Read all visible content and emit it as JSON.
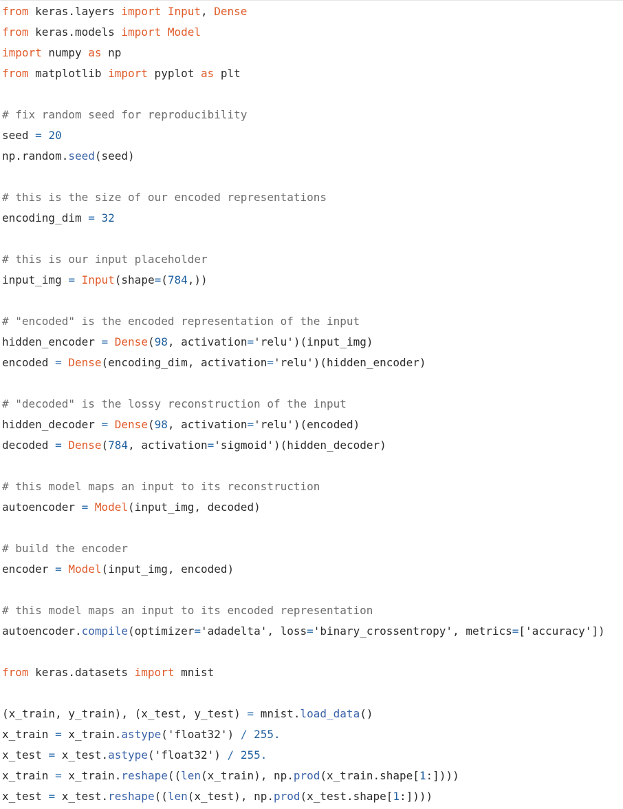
{
  "colors": {
    "background": "#ffffff",
    "text": "#2b2b2b",
    "keyword": "#e05a28",
    "number": "#1f5f9e",
    "operator": "#2f6fad",
    "comment": "#6d6d6d",
    "method": "#3a63a8"
  },
  "code_lines": [
    {
      "tokens": [
        [
          "kw",
          "from"
        ],
        [
          "plain",
          " keras.layers "
        ],
        [
          "kw",
          "import"
        ],
        [
          "plain",
          " "
        ],
        [
          "kw",
          "Input"
        ],
        [
          "plain",
          ", "
        ],
        [
          "kw",
          "Dense"
        ]
      ]
    },
    {
      "tokens": [
        [
          "kw",
          "from"
        ],
        [
          "plain",
          " keras.models "
        ],
        [
          "kw",
          "import"
        ],
        [
          "plain",
          " "
        ],
        [
          "kw",
          "Model"
        ]
      ]
    },
    {
      "tokens": [
        [
          "kw",
          "import"
        ],
        [
          "plain",
          " numpy "
        ],
        [
          "kw",
          "as"
        ],
        [
          "plain",
          " np"
        ]
      ]
    },
    {
      "tokens": [
        [
          "kw",
          "from"
        ],
        [
          "plain",
          " matplotlib "
        ],
        [
          "kw",
          "import"
        ],
        [
          "plain",
          " pyplot "
        ],
        [
          "kw",
          "as"
        ],
        [
          "plain",
          " plt"
        ]
      ]
    },
    {
      "tokens": []
    },
    {
      "tokens": [
        [
          "com",
          "# fix random seed for reproducibility"
        ]
      ]
    },
    {
      "tokens": [
        [
          "plain",
          "seed "
        ],
        [
          "op",
          "="
        ],
        [
          "plain",
          " "
        ],
        [
          "num",
          "20"
        ]
      ]
    },
    {
      "tokens": [
        [
          "plain",
          "np.random."
        ],
        [
          "meth",
          "seed"
        ],
        [
          "plain",
          "(seed)"
        ]
      ]
    },
    {
      "tokens": []
    },
    {
      "tokens": [
        [
          "com",
          "# this is the size of our encoded representations"
        ]
      ]
    },
    {
      "tokens": [
        [
          "plain",
          "encoding_dim "
        ],
        [
          "op",
          "="
        ],
        [
          "plain",
          " "
        ],
        [
          "num",
          "32"
        ]
      ]
    },
    {
      "tokens": []
    },
    {
      "tokens": [
        [
          "com",
          "# this is our input placeholder"
        ]
      ]
    },
    {
      "tokens": [
        [
          "plain",
          "input_img "
        ],
        [
          "op",
          "="
        ],
        [
          "plain",
          " "
        ],
        [
          "kw",
          "Input"
        ],
        [
          "plain",
          "(shape"
        ],
        [
          "op",
          "="
        ],
        [
          "plain",
          "("
        ],
        [
          "num",
          "784"
        ],
        [
          "plain",
          ",))"
        ]
      ]
    },
    {
      "tokens": []
    },
    {
      "tokens": [
        [
          "com",
          "# \"encoded\" is the encoded representation of the input"
        ]
      ]
    },
    {
      "tokens": [
        [
          "plain",
          "hidden_encoder "
        ],
        [
          "op",
          "="
        ],
        [
          "plain",
          " "
        ],
        [
          "kw",
          "Dense"
        ],
        [
          "plain",
          "("
        ],
        [
          "num",
          "98"
        ],
        [
          "plain",
          ", activation"
        ],
        [
          "op",
          "="
        ],
        [
          "str",
          "'relu'"
        ],
        [
          "plain",
          ")(input_img)"
        ]
      ]
    },
    {
      "tokens": [
        [
          "plain",
          "encoded "
        ],
        [
          "op",
          "="
        ],
        [
          "plain",
          " "
        ],
        [
          "kw",
          "Dense"
        ],
        [
          "plain",
          "(encoding_dim, activation"
        ],
        [
          "op",
          "="
        ],
        [
          "str",
          "'relu'"
        ],
        [
          "plain",
          ")(hidden_encoder)"
        ]
      ]
    },
    {
      "tokens": []
    },
    {
      "tokens": [
        [
          "com",
          "# \"decoded\" is the lossy reconstruction of the input"
        ]
      ]
    },
    {
      "tokens": [
        [
          "plain",
          "hidden_decoder "
        ],
        [
          "op",
          "="
        ],
        [
          "plain",
          " "
        ],
        [
          "kw",
          "Dense"
        ],
        [
          "plain",
          "("
        ],
        [
          "num",
          "98"
        ],
        [
          "plain",
          ", activation"
        ],
        [
          "op",
          "="
        ],
        [
          "str",
          "'relu'"
        ],
        [
          "plain",
          ")(encoded)"
        ]
      ]
    },
    {
      "tokens": [
        [
          "plain",
          "decoded "
        ],
        [
          "op",
          "="
        ],
        [
          "plain",
          " "
        ],
        [
          "kw",
          "Dense"
        ],
        [
          "plain",
          "("
        ],
        [
          "num",
          "784"
        ],
        [
          "plain",
          ", activation"
        ],
        [
          "op",
          "="
        ],
        [
          "str",
          "'sigmoid'"
        ],
        [
          "plain",
          ")(hidden_decoder)"
        ]
      ]
    },
    {
      "tokens": []
    },
    {
      "tokens": [
        [
          "com",
          "# this model maps an input to its reconstruction"
        ]
      ]
    },
    {
      "tokens": [
        [
          "plain",
          "autoencoder "
        ],
        [
          "op",
          "="
        ],
        [
          "plain",
          " "
        ],
        [
          "kw",
          "Model"
        ],
        [
          "plain",
          "(input_img, decoded)"
        ]
      ]
    },
    {
      "tokens": []
    },
    {
      "tokens": [
        [
          "com",
          "# build the encoder"
        ]
      ]
    },
    {
      "tokens": [
        [
          "plain",
          "encoder "
        ],
        [
          "op",
          "="
        ],
        [
          "plain",
          " "
        ],
        [
          "kw",
          "Model"
        ],
        [
          "plain",
          "(input_img, encoded)"
        ]
      ]
    },
    {
      "tokens": []
    },
    {
      "tokens": [
        [
          "com",
          "# this model maps an input to its encoded representation"
        ]
      ]
    },
    {
      "tokens": [
        [
          "plain",
          "autoencoder."
        ],
        [
          "meth",
          "compile"
        ],
        [
          "plain",
          "(optimizer"
        ],
        [
          "op",
          "="
        ],
        [
          "str",
          "'adadelta'"
        ],
        [
          "plain",
          ", loss"
        ],
        [
          "op",
          "="
        ],
        [
          "str",
          "'binary_crossentropy'"
        ],
        [
          "plain",
          ", metrics"
        ],
        [
          "op",
          "="
        ],
        [
          "plain",
          "["
        ],
        [
          "str",
          "'accuracy'"
        ],
        [
          "plain",
          "])"
        ]
      ]
    },
    {
      "tokens": []
    },
    {
      "tokens": [
        [
          "kw",
          "from"
        ],
        [
          "plain",
          " keras.datasets "
        ],
        [
          "kw",
          "import"
        ],
        [
          "plain",
          " mnist"
        ]
      ]
    },
    {
      "tokens": []
    },
    {
      "tokens": [
        [
          "plain",
          "(x_train, y_train), (x_test, y_test) "
        ],
        [
          "op",
          "="
        ],
        [
          "plain",
          " mnist."
        ],
        [
          "meth",
          "load_data"
        ],
        [
          "plain",
          "()"
        ]
      ]
    },
    {
      "tokens": [
        [
          "plain",
          "x_train "
        ],
        [
          "op",
          "="
        ],
        [
          "plain",
          " x_train."
        ],
        [
          "meth",
          "astype"
        ],
        [
          "plain",
          "("
        ],
        [
          "str",
          "'float32'"
        ],
        [
          "plain",
          ") "
        ],
        [
          "op",
          "/"
        ],
        [
          "plain",
          " "
        ],
        [
          "num",
          "255."
        ]
      ]
    },
    {
      "tokens": [
        [
          "plain",
          "x_test "
        ],
        [
          "op",
          "="
        ],
        [
          "plain",
          " x_test."
        ],
        [
          "meth",
          "astype"
        ],
        [
          "plain",
          "("
        ],
        [
          "str",
          "'float32'"
        ],
        [
          "plain",
          ") "
        ],
        [
          "op",
          "/"
        ],
        [
          "plain",
          " "
        ],
        [
          "num",
          "255."
        ]
      ]
    },
    {
      "tokens": [
        [
          "plain",
          "x_train "
        ],
        [
          "op",
          "="
        ],
        [
          "plain",
          " x_train."
        ],
        [
          "meth",
          "reshape"
        ],
        [
          "plain",
          "(("
        ],
        [
          "meth",
          "len"
        ],
        [
          "plain",
          "(x_train), np."
        ],
        [
          "meth",
          "prod"
        ],
        [
          "plain",
          "(x_train.shape["
        ],
        [
          "num",
          "1"
        ],
        [
          "plain",
          ":])))"
        ]
      ]
    },
    {
      "tokens": [
        [
          "plain",
          "x_test "
        ],
        [
          "op",
          "="
        ],
        [
          "plain",
          " x_test."
        ],
        [
          "meth",
          "reshape"
        ],
        [
          "plain",
          "(("
        ],
        [
          "meth",
          "len"
        ],
        [
          "plain",
          "(x_test), np."
        ],
        [
          "meth",
          "prod"
        ],
        [
          "plain",
          "(x_test.shape["
        ],
        [
          "num",
          "1"
        ],
        [
          "plain",
          ":])))"
        ]
      ]
    }
  ]
}
